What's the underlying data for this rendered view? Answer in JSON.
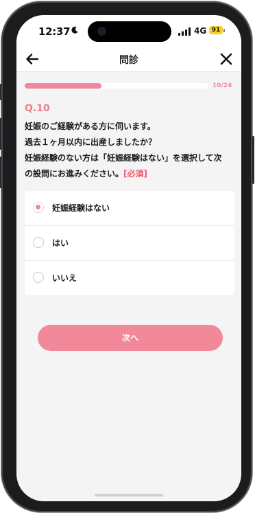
{
  "status_bar": {
    "time": "12:37",
    "network": "4G",
    "battery": "91",
    "battery_color": "#f3d12b"
  },
  "nav": {
    "title": "問診",
    "back_icon": "arrow-left-icon",
    "close_icon": "close-icon"
  },
  "progress": {
    "count_label": "10/24",
    "current": 10,
    "total": 24,
    "color": "#ef8a9c"
  },
  "question": {
    "number": "Q.10",
    "lines": [
      "妊娠のご経験がある方に伺います。",
      "過去１ヶ月以内に出産しましたか？",
      "妊娠経験のない方は「妊娠経験はない」を選択して次",
      "の設問にお進みください。"
    ],
    "required_tag": "[必須]"
  },
  "options": [
    {
      "label": "妊娠経験はない",
      "selected": true
    },
    {
      "label": "はい",
      "selected": false
    },
    {
      "label": "いいえ",
      "selected": false
    }
  ],
  "next_button": {
    "label": "次へ",
    "color": "#f2899b"
  },
  "accent_color": "#ef7f90"
}
